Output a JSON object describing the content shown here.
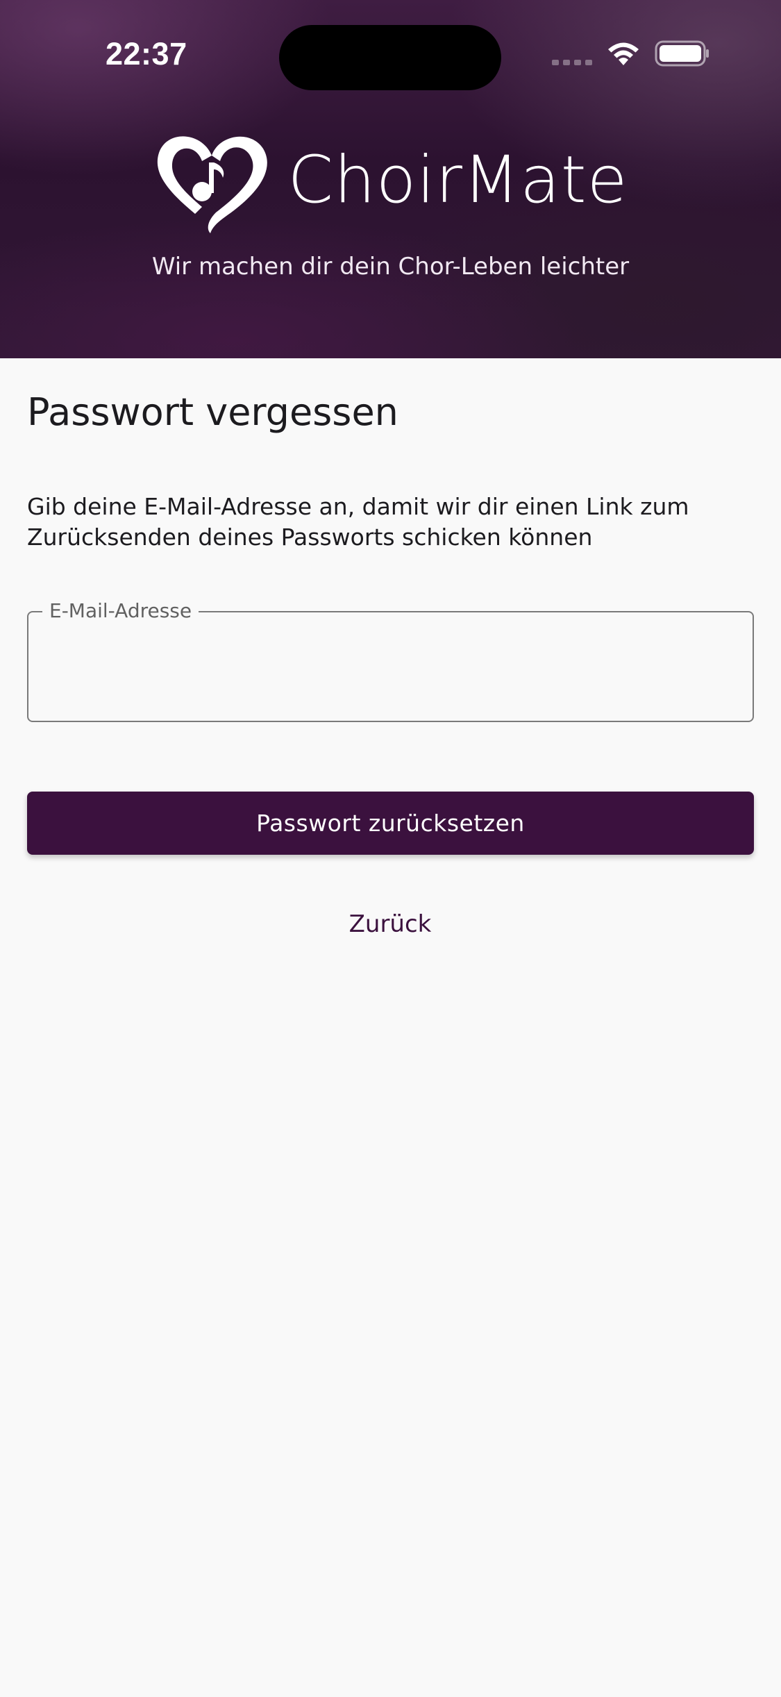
{
  "status_bar": {
    "time": "22:37"
  },
  "header": {
    "brand_name": "ChoirMate",
    "tagline": "Wir machen dir dein Chor-Leben leichter",
    "logo_icon": "heart-music-note-icon"
  },
  "main": {
    "title": "Passwort vergessen",
    "description": "Gib deine E-Mail-Adresse an, damit wir dir einen Link zum Zurücksenden deines Passworts schicken können",
    "email_field": {
      "label": "E-Mail-Adresse",
      "value": ""
    },
    "reset_button_label": "Passwort zurücksetzen",
    "back_button_label": "Zurück"
  },
  "colors": {
    "primary": "#3b113e",
    "header_background": "#2c1230",
    "page_background": "#f9f9f9"
  }
}
